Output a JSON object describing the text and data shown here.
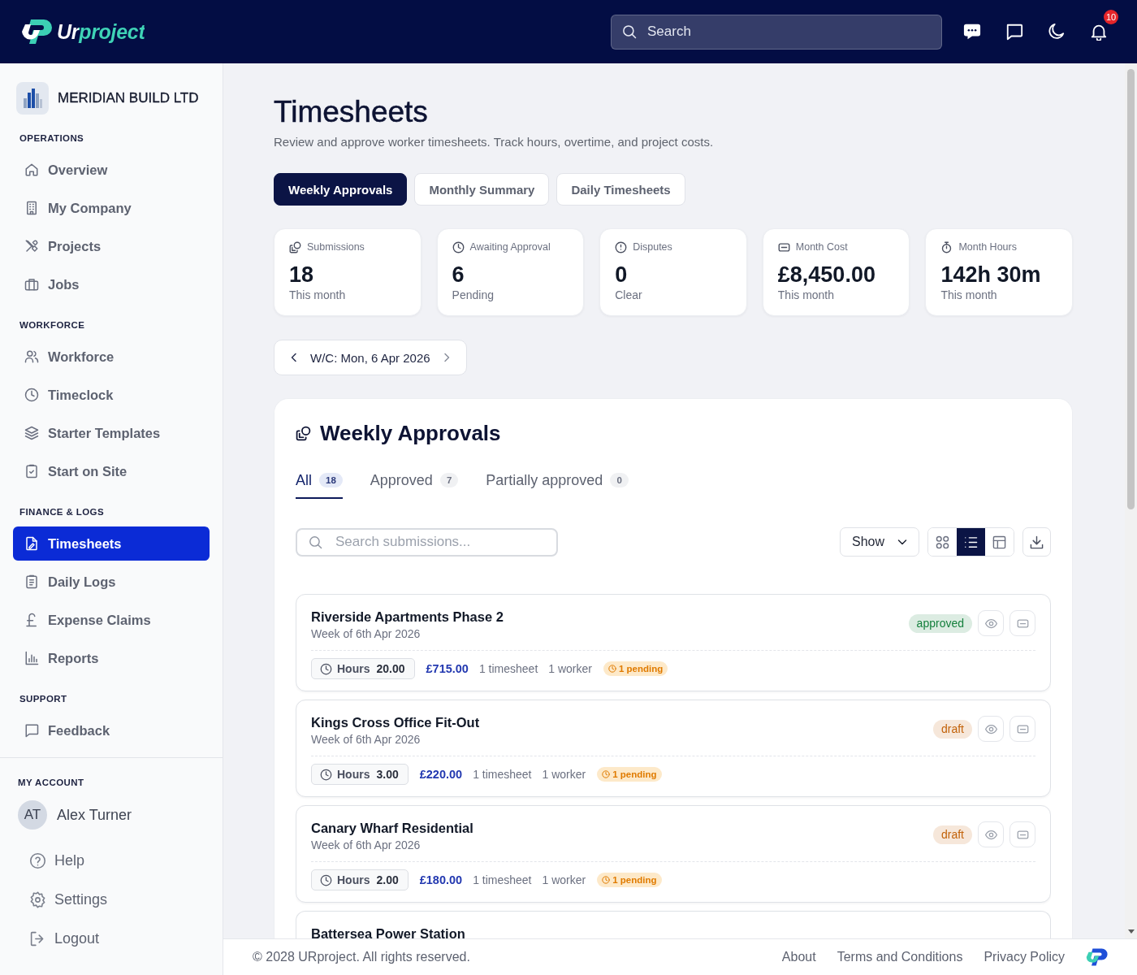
{
  "topbar": {
    "brand": "Urproject",
    "search": {
      "placeholder": "Search"
    },
    "notifications": {
      "count": "10"
    }
  },
  "sidebar": {
    "company": "MERIDIAN BUILD LTD",
    "sections": [
      {
        "title": "OPERATIONS",
        "items": [
          {
            "label": "Overview",
            "selected": false
          },
          {
            "label": "My Company",
            "selected": false
          },
          {
            "label": "Projects",
            "selected": false
          },
          {
            "label": "Jobs",
            "selected": false
          }
        ]
      },
      {
        "title": "WORKFORCE",
        "items": [
          {
            "label": "Workforce",
            "selected": false
          },
          {
            "label": "Timeclock",
            "selected": false
          },
          {
            "label": "Starter Templates",
            "selected": false
          },
          {
            "label": "Start on Site",
            "selected": false
          }
        ]
      },
      {
        "title": "FINANCE & LOGS",
        "items": [
          {
            "label": "Timesheets",
            "selected": true
          },
          {
            "label": "Daily Logs",
            "selected": false
          },
          {
            "label": "Expense Claims",
            "selected": false
          },
          {
            "label": "Reports",
            "selected": false
          }
        ]
      },
      {
        "title": "SUPPORT",
        "items": [
          {
            "label": "Feedback",
            "selected": false
          }
        ]
      }
    ],
    "account": {
      "title": "MY ACCOUNT",
      "user": {
        "initials": "AT",
        "name": "Alex Turner"
      },
      "links": [
        "Help",
        "Settings",
        "Logout"
      ]
    }
  },
  "page": {
    "title": "Timesheets",
    "subtitle": "Review and approve worker timesheets. Track hours, overtime, and project costs.",
    "tabs": [
      {
        "label": "Weekly Approvals",
        "selected": true
      },
      {
        "label": "Monthly Summary",
        "selected": false
      },
      {
        "label": "Daily Timesheets",
        "selected": false
      }
    ],
    "stats": [
      {
        "label": "Submissions",
        "value": "18",
        "note": "This month"
      },
      {
        "label": "Awaiting Approval",
        "value": "6",
        "note": "Pending"
      },
      {
        "label": "Disputes",
        "value": "0",
        "note": "Clear"
      },
      {
        "label": "Month Cost",
        "value": "£8,450.00",
        "note": "This month"
      },
      {
        "label": "Month Hours",
        "value": "142h 30m",
        "note": "This month"
      }
    ],
    "week": "W/C: Mon, 6 Apr 2026"
  },
  "panel": {
    "title": "Weekly Approvals",
    "filters": [
      {
        "label": "All",
        "count": "18",
        "selected": true
      },
      {
        "label": "Approved",
        "count": "7",
        "selected": false
      },
      {
        "label": "Partially approved",
        "count": "0",
        "selected": false
      }
    ],
    "search": {
      "placeholder": "Search submissions..."
    },
    "show": "Show",
    "views": [
      {
        "kind": "grid",
        "selected": false
      },
      {
        "kind": "list",
        "selected": true
      },
      {
        "kind": "table",
        "selected": false
      }
    ],
    "rows": [
      {
        "name": "Riverside Apartments Phase 2",
        "week": "Week of 6th Apr 2026",
        "status": {
          "label": "approved",
          "color": "#15803d"
        },
        "hours_label": "Hours",
        "hours": "20.00",
        "amount": "£715.00",
        "timesheets": "1 timesheet",
        "workers": "1 worker",
        "pending": "1 pending"
      },
      {
        "name": "Kings Cross Office Fit-Out",
        "week": "Week of 6th Apr 2026",
        "status": {
          "label": "draft",
          "color": "#c2620a"
        },
        "hours_label": "Hours",
        "hours": "3.00",
        "amount": "£220.00",
        "timesheets": "1 timesheet",
        "workers": "1 worker",
        "pending": "1 pending"
      },
      {
        "name": "Canary Wharf Residential",
        "week": "Week of 6th Apr 2026",
        "status": {
          "label": "draft",
          "color": "#c2620a"
        },
        "hours_label": "Hours",
        "hours": "2.00",
        "amount": "£180.00",
        "timesheets": "1 timesheet",
        "workers": "1 worker",
        "pending": "1 pending"
      },
      {
        "name": "Battersea Power Station"
      }
    ]
  },
  "footer": {
    "copyright": "© 2028 URproject. All rights reserved.",
    "links": [
      "About",
      "Terms and Conditions",
      "Privacy Policy"
    ]
  }
}
